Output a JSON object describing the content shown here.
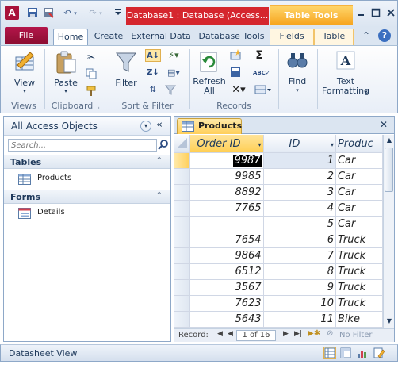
{
  "titlebar": {
    "app_letter": "A",
    "db_title": "Database1 : Database (Access...",
    "context_title": "Table Tools"
  },
  "tabs": {
    "file": "File",
    "home": "Home",
    "create": "Create",
    "external": "External Data",
    "dbtools": "Database Tools",
    "fields": "Fields",
    "table": "Table"
  },
  "ribbon": {
    "view": "View",
    "paste": "Paste",
    "filter": "Filter",
    "refresh_line1": "Refresh",
    "refresh_line2": "All",
    "find": "Find",
    "text_line1": "Text",
    "text_line2": "Formatting",
    "groups": {
      "views": "Views",
      "clipboard": "Clipboard",
      "sort_filter": "Sort & Filter",
      "records": "Records"
    }
  },
  "nav": {
    "title": "All Access Objects",
    "search_placeholder": "Search...",
    "groups": [
      {
        "title": "Tables",
        "items": [
          "Products"
        ]
      },
      {
        "title": "Forms",
        "items": [
          "Details"
        ]
      }
    ]
  },
  "sheet": {
    "tab_label": "Products",
    "columns": [
      "Order ID",
      "ID",
      "Produc"
    ],
    "rows": [
      [
        "9987",
        "1",
        "Car"
      ],
      [
        "9985",
        "2",
        "Car"
      ],
      [
        "8892",
        "3",
        "Car"
      ],
      [
        "7765",
        "4",
        "Car"
      ],
      [
        "",
        "5",
        "Car"
      ],
      [
        "7654",
        "6",
        "Truck"
      ],
      [
        "9864",
        "7",
        "Truck"
      ],
      [
        "6512",
        "8",
        "Truck"
      ],
      [
        "3567",
        "9",
        "Truck"
      ],
      [
        "7623",
        "10",
        "Truck"
      ],
      [
        "5643",
        "11",
        "Bike"
      ]
    ],
    "recnav": {
      "label": "Record:",
      "current": "1 of 16",
      "filter": "No Filter"
    }
  },
  "status": {
    "text": "Datasheet View"
  },
  "colors": {
    "file_tab": "#a8123a",
    "title_red": "#d5262e",
    "context_orange": "#f6a31c",
    "selection": "#ffcf54"
  }
}
